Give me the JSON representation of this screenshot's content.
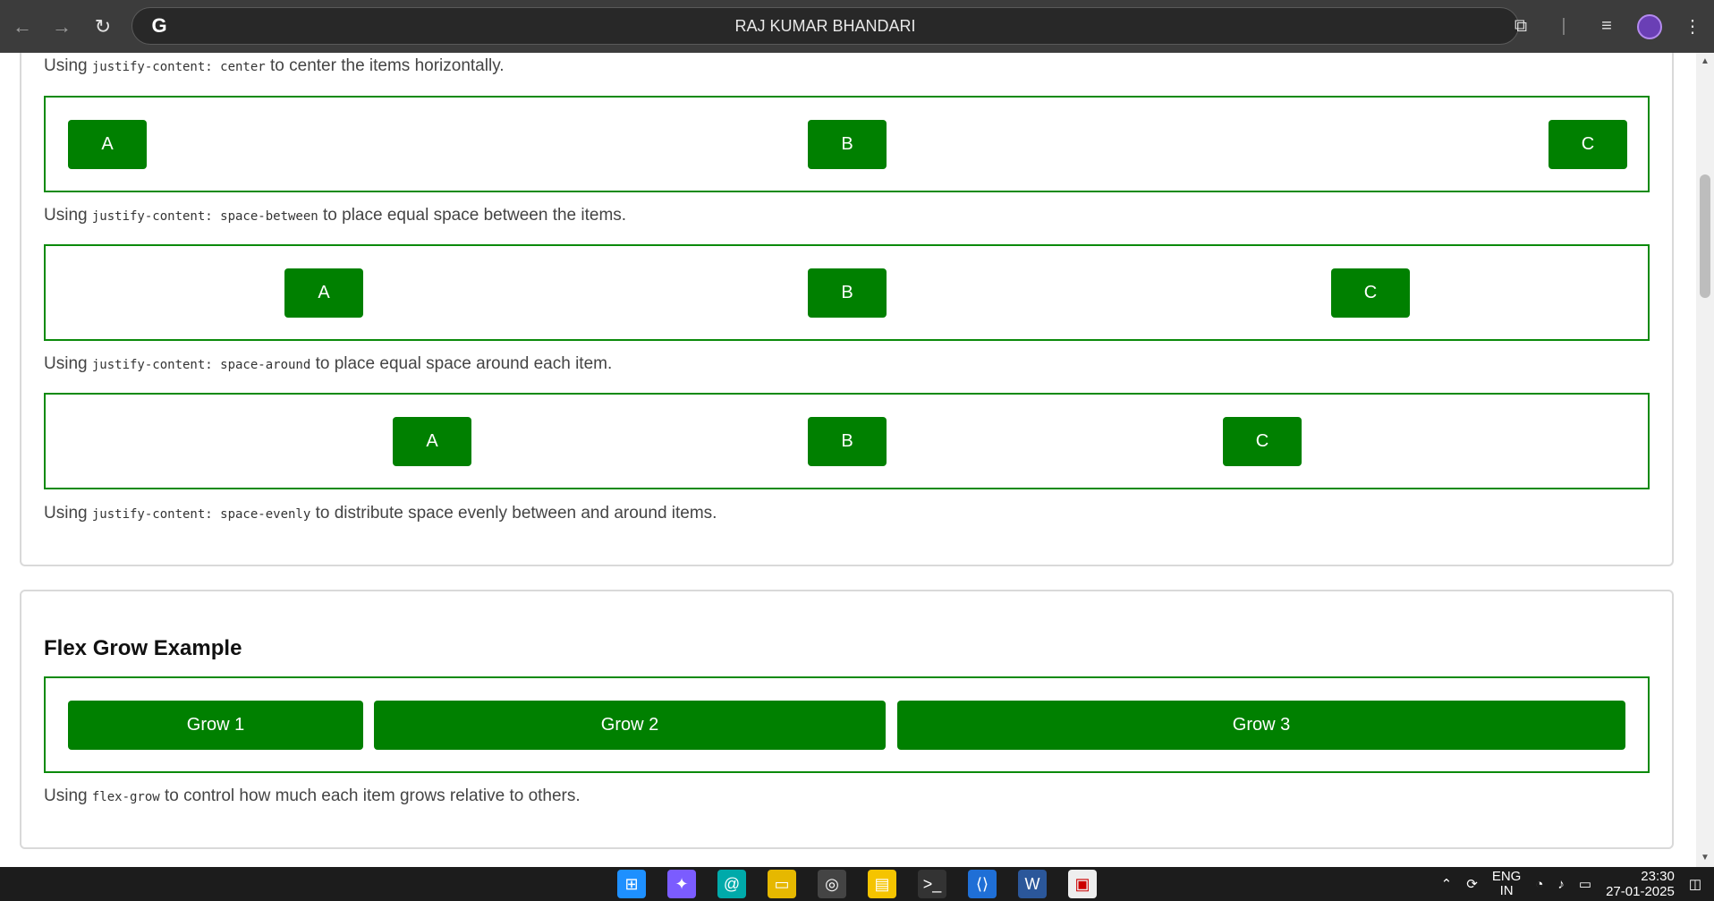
{
  "browser": {
    "title": "RAJ KUMAR BHANDARI",
    "back_icon": "arrow-left-icon",
    "forward_icon": "arrow-right-icon",
    "reload_icon": "reload-icon",
    "google_letter": "G"
  },
  "section1": {
    "center_desc": {
      "prefix": "Using ",
      "code": "justify-content: center",
      "suffix": " to center the items horizontally."
    },
    "between_desc": {
      "prefix": "Using ",
      "code": "justify-content: space-between",
      "suffix": " to place equal space between the items."
    },
    "around_desc": {
      "prefix": "Using ",
      "code": "justify-content: space-around",
      "suffix": " to place equal space around each item."
    },
    "evenly_desc": {
      "prefix": "Using ",
      "code": "justify-content: space-evenly",
      "suffix": " to distribute space evenly between and around items."
    },
    "box1": [
      "A",
      "B",
      "C"
    ],
    "box2": [
      "A",
      "B",
      "C"
    ],
    "box3": [
      "A",
      "B",
      "C"
    ]
  },
  "section2": {
    "title": "Flex Grow Example",
    "items": [
      "Grow 1",
      "Grow 2",
      "Grow 3"
    ],
    "desc": {
      "prefix": "Using ",
      "code": "flex-grow",
      "suffix": " to control how much each item grows relative to others."
    }
  },
  "taskbar": {
    "lang_top": "ENG",
    "lang_bottom": "IN",
    "time": "23:30",
    "date": "27-01-2025"
  },
  "colors": {
    "accent": "#008000",
    "border": "#0b8a0b"
  }
}
